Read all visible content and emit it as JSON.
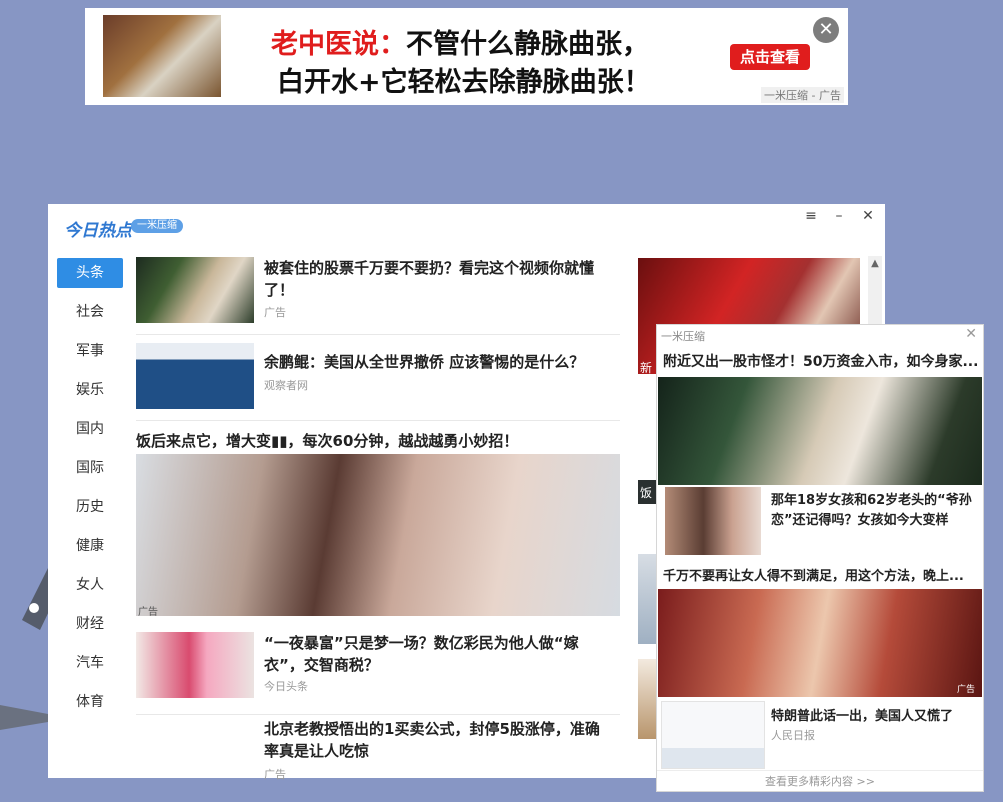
{
  "top_ad": {
    "headline_lead": "老中医说：",
    "headline_line1": "不管什么静脉曲张，",
    "headline_line2": "白开水+它轻松去除静脉曲张！",
    "cta": "点击查看",
    "close_glyph": "✕",
    "tag": "一米压缩 - 广告"
  },
  "main_window": {
    "logo": "今日热点",
    "logo_badge": "一米压缩",
    "controls": {
      "menu": "≡",
      "minimize": "–",
      "close": "✕"
    },
    "nav": [
      "头条",
      "社会",
      "军事",
      "娱乐",
      "国内",
      "国际",
      "历史",
      "健康",
      "女人",
      "财经",
      "汽车",
      "体育"
    ],
    "active_nav": "头条",
    "feed": [
      {
        "title": "被套住的股票千万要不要扔？看完这个视频你就懂了！",
        "source": "广告"
      },
      {
        "title": "余鹏鲲：美国从全世界撤侨 应该警惕的是什么？",
        "source": "观察者网"
      },
      {
        "title": "“一夜暴富”只是梦一场？数亿彩民为他人做“嫁衣”，交智商税？",
        "source": "今日头条"
      },
      {
        "title": "北京老教授悟出的1买卖公式，封停5股涨停，准确率真是让人吃惊",
        "source": "广告"
      }
    ],
    "big_item": {
      "title": "饭后来点它，增大变▮▮，每次60分钟，越战越勇小妙招！",
      "source": "广告"
    },
    "right_col_labels": [
      "新",
      "饭"
    ],
    "scroll_up": "▲"
  },
  "popup": {
    "header": "一米压缩",
    "close_glyph": "✕",
    "item1_title": "附近又出一股市怪才！50万资金入市，如今身家...",
    "item2_title": "那年18岁女孩和62岁老头的“爷孙恋”还记得吗？女孩如今大变样",
    "item3_title": "千万不要再让女人得不到满足，用这个方法，晚上...",
    "item4_title": "特朗普此话一出，美国人又慌了",
    "item4_source": "人民日报",
    "ad_mark": "广告",
    "more": "查看更多精彩内容 >>"
  }
}
